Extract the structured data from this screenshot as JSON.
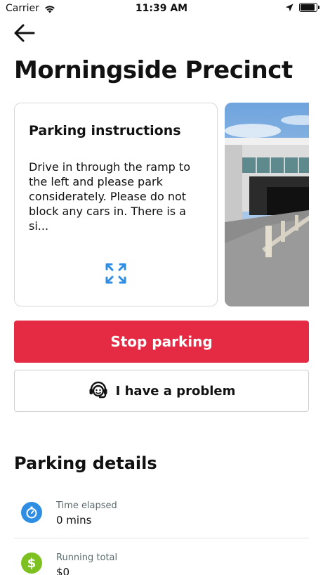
{
  "status_bar": {
    "carrier": "Carrier",
    "time": "11:39 AM",
    "wifi_icon": "wifi-icon",
    "location_icon": "location-arrow-icon",
    "battery_icon": "battery-icon"
  },
  "header": {
    "back_icon": "arrow-left-icon",
    "title": "Morningside Precinct"
  },
  "instructions_card": {
    "title": "Parking instructions",
    "body": "Drive in through the ramp to the left and please park considerately. Please do not block any cars in. There is a si...",
    "expand_icon": "expand-icon"
  },
  "photo_card": {
    "image": "parking-garage-photo"
  },
  "actions": {
    "stop_label": "Stop parking",
    "problem_label": "I have a problem",
    "problem_icon": "headset-support-icon"
  },
  "details": {
    "section_title": "Parking details",
    "items": [
      {
        "label": "Time elapsed",
        "value": "0 mins",
        "icon": "stopwatch-icon",
        "color": "#2f8de4"
      },
      {
        "label": "Running total",
        "value": "$0",
        "icon": "dollar-icon",
        "color": "#7cc11f"
      }
    ]
  },
  "colors": {
    "accent_red": "#e52b44",
    "link_blue": "#2f8de4",
    "money_green": "#7cc11f"
  }
}
